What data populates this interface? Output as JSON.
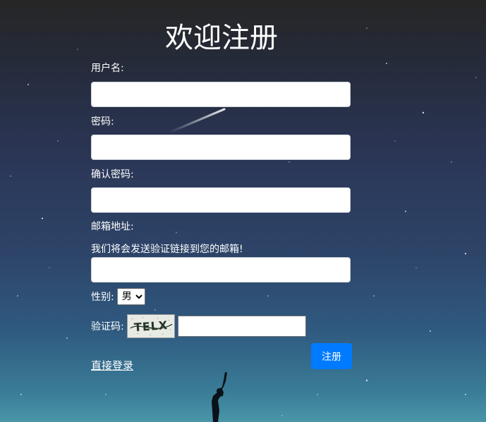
{
  "page": {
    "title": "欢迎注册"
  },
  "form": {
    "username_label": "用户名:",
    "username_value": "",
    "password_label": "密码:",
    "password_value": "",
    "confirm_label": "确认密码:",
    "confirm_value": "",
    "email_label": "邮箱地址:",
    "email_hint": "我们将会发送验证链接到您的邮箱!",
    "email_value": "",
    "gender_label": "性别:",
    "gender_selected": "男",
    "captcha_label": "验证码:",
    "captcha_image_text": "TELX",
    "captcha_value": "",
    "submit_label": "注册",
    "login_link": "直接登录"
  },
  "colors": {
    "button": "#007bff",
    "background_top": "#262626",
    "background_bottom": "#4a95a8"
  }
}
